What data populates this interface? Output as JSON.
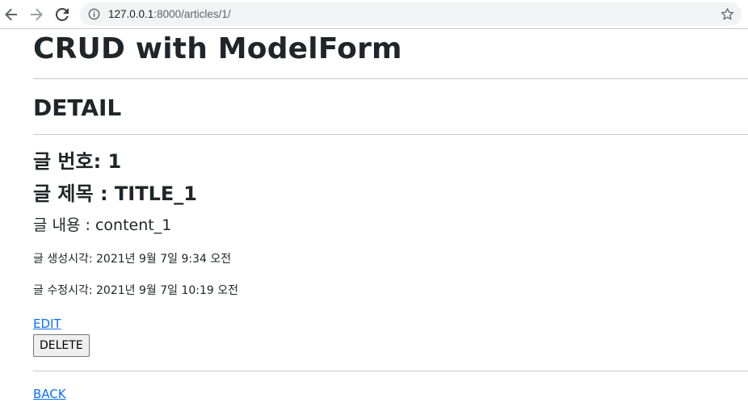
{
  "browser": {
    "url_host": "127.0.0.1",
    "url_port_path": ":8000/articles/1/",
    "back_icon": "arrow-left-icon",
    "forward_icon": "arrow-right-icon",
    "reload_icon": "reload-icon",
    "info_icon": "info-icon",
    "bookmark_icon": "star-icon",
    "colors": {
      "url_text": "#202124",
      "omnibox_bg": "#f1f3f4"
    }
  },
  "page": {
    "site_title": "CRUD with ModelForm",
    "section_title": "DETAIL",
    "article_number_line": "글 번호: 1",
    "article_title_line": "글 제목 : TITLE_1",
    "article_content_line": "글 내용 : content_1",
    "created_line": "글 생성시각: 2021년 9월 7일 9:34 오전",
    "updated_line": "글 수정시각: 2021년 9월 7일 10:19 오전",
    "edit_link": "EDIT",
    "delete_button": "DELETE",
    "back_link": "BACK",
    "colors": {
      "text": "#212529",
      "link": "#0d6efd",
      "divider": "#c9c9c9"
    }
  }
}
